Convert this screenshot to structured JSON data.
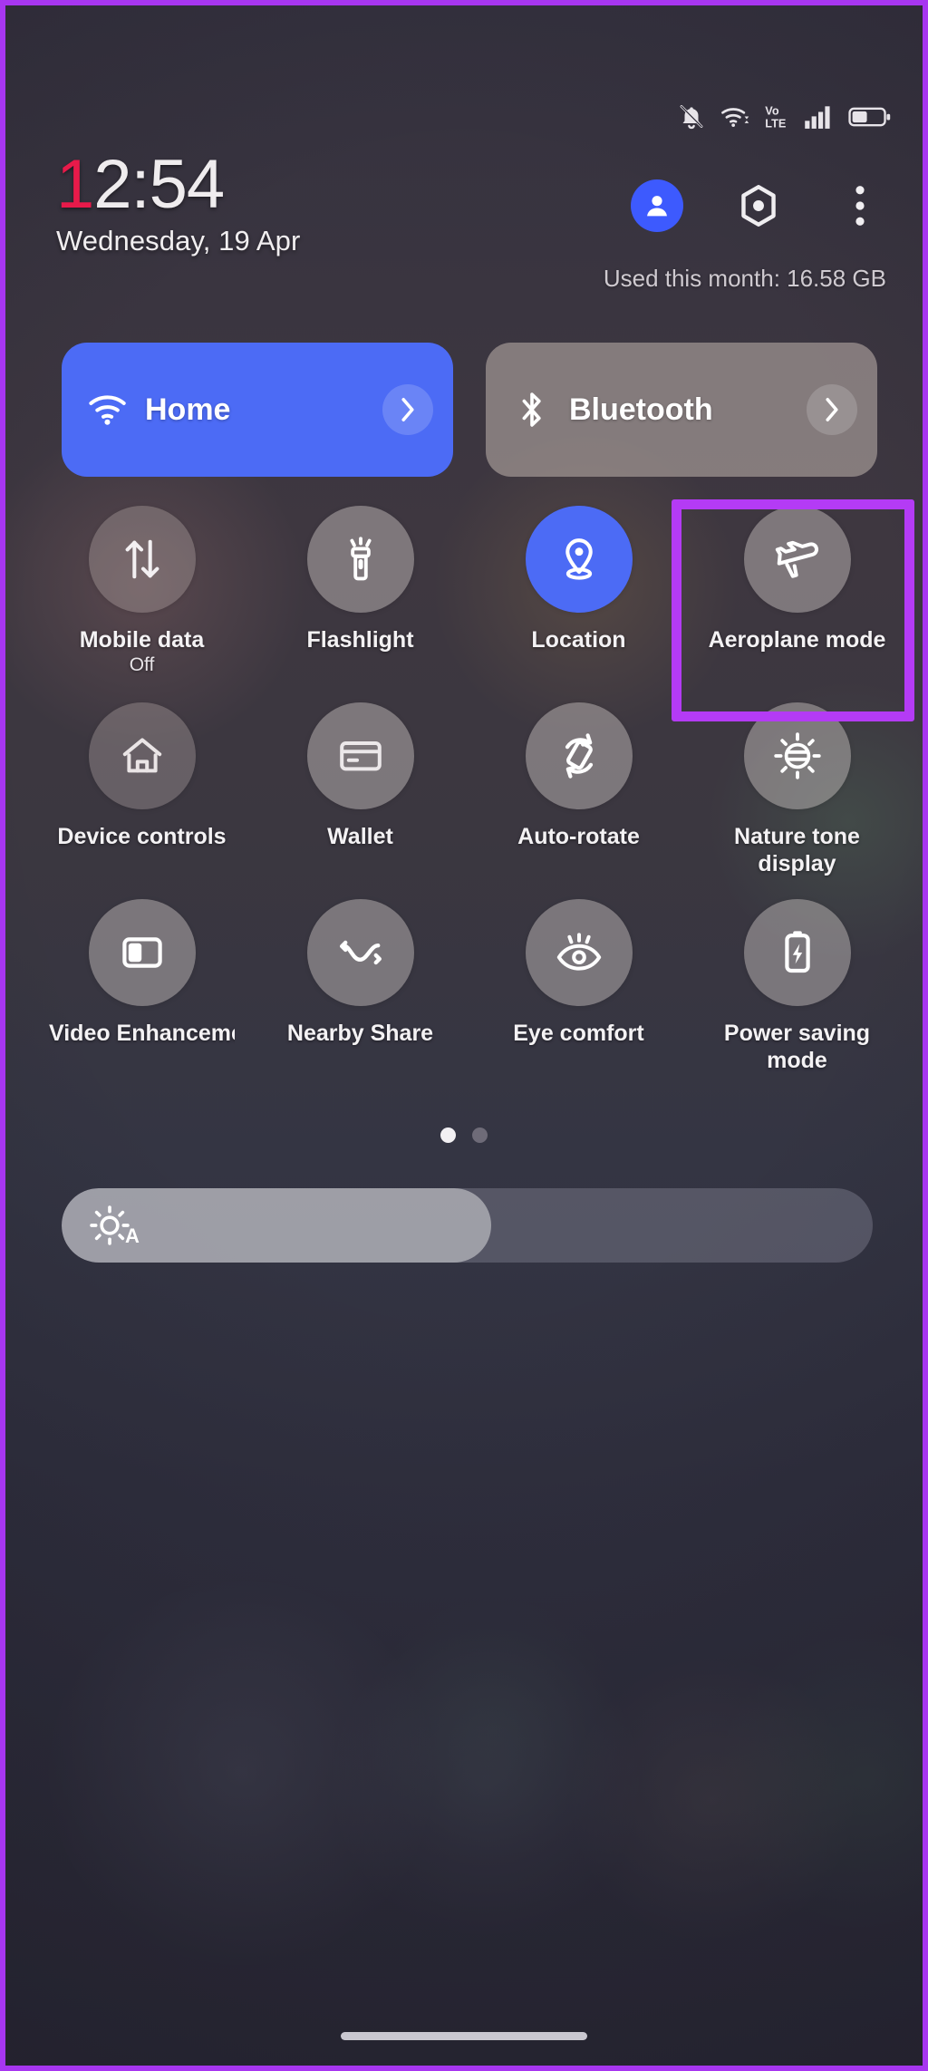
{
  "colors": {
    "highlight_border": "#b43bf5",
    "page_border": "#a736f0",
    "accent_blue": "#4c6bf5",
    "clock_red": "#e81a4a"
  },
  "statusbar": {
    "icons": [
      {
        "name": "notifications-muted-icon",
        "label": "Notifications muted"
      },
      {
        "name": "wifi-icon",
        "label": "Wi-Fi connected"
      },
      {
        "name": "volte-icon",
        "label": "VoLTE"
      },
      {
        "name": "signal-bars-icon",
        "label": "Mobile signal full"
      },
      {
        "name": "battery-icon",
        "label": "Battery"
      }
    ]
  },
  "header": {
    "clock_hour_first": "1",
    "clock_rest": "2:54",
    "date": "Wednesday, 19 Apr",
    "data_usage": "Used this month: 16.58 GB",
    "buttons": [
      {
        "name": "user-avatar-button",
        "icon": "person-icon"
      },
      {
        "name": "settings-button",
        "icon": "gear-hexagon-icon"
      },
      {
        "name": "overflow-menu-button",
        "icon": "three-dots-vertical-icon"
      }
    ]
  },
  "pills": [
    {
      "label": "Home",
      "icon": "wifi-icon",
      "state": "on"
    },
    {
      "label": "Bluetooth",
      "icon": "bluetooth-icon",
      "state": "off"
    }
  ],
  "tiles": [
    {
      "label": "Mobile data",
      "sublabel": "Off",
      "icon": "data-transfer-icon",
      "state": "dim"
    },
    {
      "label": "Flashlight",
      "sublabel": "",
      "icon": "flashlight-icon",
      "state": "off"
    },
    {
      "label": "Location",
      "sublabel": "",
      "icon": "location-pin-icon",
      "state": "active"
    },
    {
      "label": "Aeroplane mode",
      "sublabel": "",
      "icon": "aeroplane-icon",
      "state": "off",
      "highlighted": true
    },
    {
      "label": "Device controls",
      "sublabel": "",
      "icon": "home-icon",
      "state": "dim"
    },
    {
      "label": "Wallet",
      "sublabel": "",
      "icon": "card-icon",
      "state": "off"
    },
    {
      "label": "Auto-rotate",
      "sublabel": "",
      "icon": "auto-rotate-icon",
      "state": "off"
    },
    {
      "label": "Nature tone display",
      "sublabel": "",
      "icon": "nature-tone-icon",
      "state": "off"
    },
    {
      "label": "Video Enhancement",
      "sublabel": "",
      "icon": "video-enhancement-icon",
      "state": "off"
    },
    {
      "label": "Nearby Share",
      "sublabel": "",
      "icon": "nearby-share-icon",
      "state": "off"
    },
    {
      "label": "Eye comfort",
      "sublabel": "",
      "icon": "eye-comfort-icon",
      "state": "off"
    },
    {
      "label": "Power saving mode",
      "sublabel": "",
      "icon": "battery-bolt-icon",
      "state": "off"
    }
  ],
  "pager": {
    "total": 2,
    "current": 1
  },
  "brightness": {
    "icon": "auto-brightness-icon",
    "auto_label": "A",
    "value_percent": 53
  },
  "navigation": {
    "home_indicator": "gesture-bar"
  }
}
